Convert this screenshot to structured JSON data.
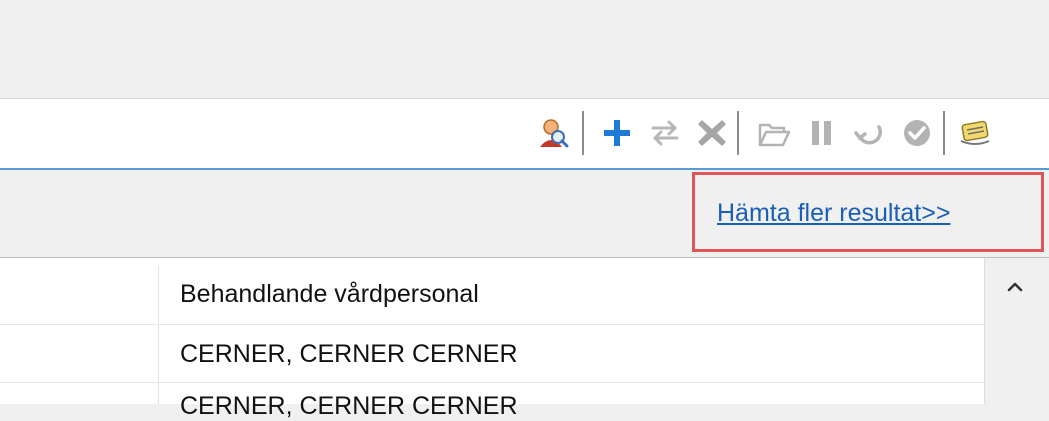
{
  "toolbar": {
    "buttons": [
      {
        "icon": "person-search-icon"
      },
      {
        "icon": "plus-icon"
      },
      {
        "icon": "swap-arrows-icon"
      },
      {
        "icon": "delete-x-icon"
      },
      {
        "icon": "open-folder-icon"
      },
      {
        "icon": "pause-icon"
      },
      {
        "icon": "undo-arrow-icon"
      },
      {
        "icon": "check-circle-icon"
      },
      {
        "icon": "notes-icon"
      },
      {
        "icon": "refresh-icon"
      },
      {
        "icon": "filter-icon"
      },
      {
        "icon": "more-options-icon"
      },
      {
        "icon": "minimize-icon"
      },
      {
        "icon": "maximize-icon"
      }
    ]
  },
  "results": {
    "fetch_more_label": "Hämta fler resultat>>"
  },
  "list": {
    "header": "Behandlande vårdpersonal",
    "rows": [
      "CERNER, CERNER CERNER",
      "CERNER, CERNER CERNER"
    ]
  },
  "colors": {
    "link": "#1a5fb4",
    "highlight_border": "#e05555",
    "accent_line": "#5b9bd5",
    "plus_blue": "#1e7ad6"
  }
}
